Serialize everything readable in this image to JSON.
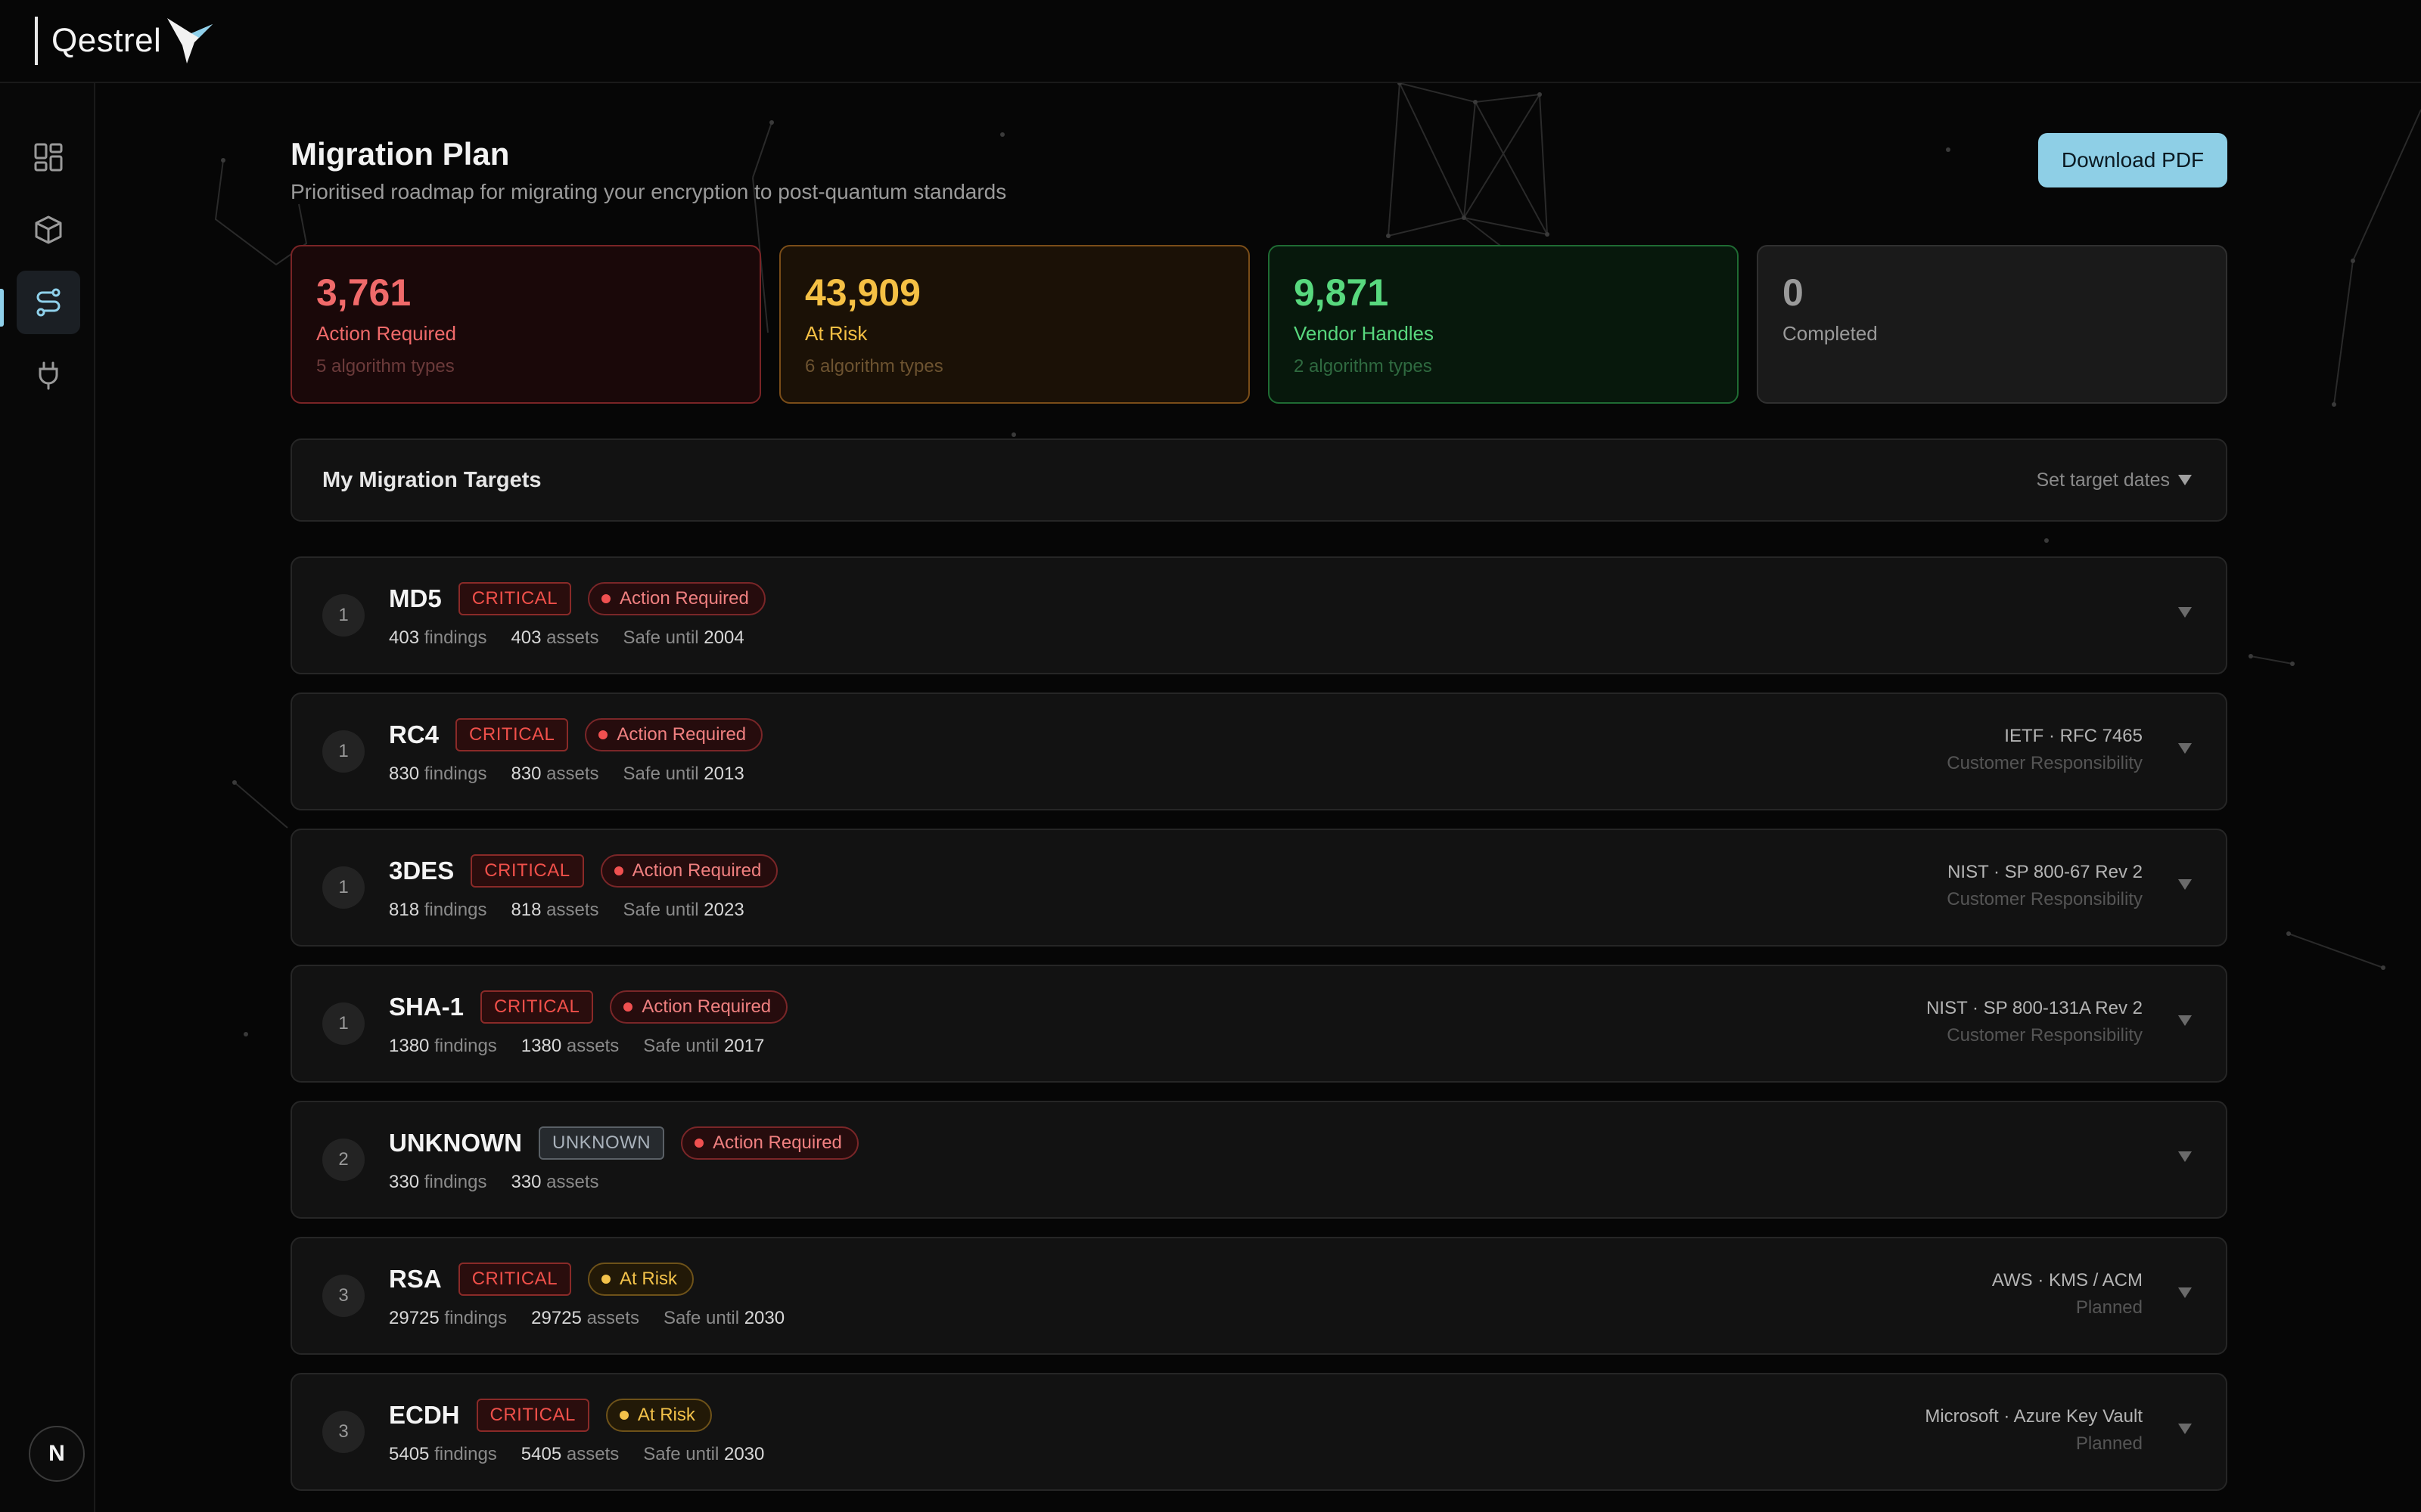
{
  "brand": {
    "name": "Qestrel"
  },
  "sidebar": {
    "items": [
      {
        "name": "dashboard",
        "icon": "dashboard-grid-icon"
      },
      {
        "name": "inventory",
        "icon": "cube-icon"
      },
      {
        "name": "migration",
        "icon": "route-icon",
        "active": true
      },
      {
        "name": "integrations",
        "icon": "plug-icon"
      }
    ],
    "avatar_initial": "N"
  },
  "page": {
    "title": "Migration Plan",
    "subtitle": "Prioritised roadmap for migrating your encryption to post-quantum standards",
    "download_label": "Download PDF"
  },
  "stats": [
    {
      "value": "3,761",
      "label": "Action Required",
      "sub": "5 algorithm types",
      "tone": "red",
      "color": "#f06a6a"
    },
    {
      "value": "43,909",
      "label": "At Risk",
      "sub": "6 algorithm types",
      "tone": "amber",
      "color": "#f5c044"
    },
    {
      "value": "9,871",
      "label": "Vendor Handles",
      "sub": "2 algorithm types",
      "tone": "green",
      "color": "#58d87e"
    },
    {
      "value": "0",
      "label": "Completed",
      "sub": "",
      "tone": "gray",
      "color": "#9a9a9a"
    }
  ],
  "targets": {
    "title": "My Migration Targets",
    "action": "Set target dates"
  },
  "algorithms": [
    {
      "priority": "1",
      "name": "MD5",
      "severity": "CRITICAL",
      "status": "Action Required",
      "findings": "403",
      "assets": "403",
      "safe_until": "2004",
      "ref": "",
      "responsibility": ""
    },
    {
      "priority": "1",
      "name": "RC4",
      "severity": "CRITICAL",
      "status": "Action Required",
      "findings": "830",
      "assets": "830",
      "safe_until": "2013",
      "ref": "IETF · RFC 7465",
      "responsibility": "Customer Responsibility"
    },
    {
      "priority": "1",
      "name": "3DES",
      "severity": "CRITICAL",
      "status": "Action Required",
      "findings": "818",
      "assets": "818",
      "safe_until": "2023",
      "ref": "NIST · SP 800-67 Rev 2",
      "responsibility": "Customer Responsibility"
    },
    {
      "priority": "1",
      "name": "SHA-1",
      "severity": "CRITICAL",
      "status": "Action Required",
      "findings": "1380",
      "assets": "1380",
      "safe_until": "2017",
      "ref": "NIST · SP 800-131A Rev 2",
      "responsibility": "Customer Responsibility"
    },
    {
      "priority": "2",
      "name": "UNKNOWN",
      "severity": "UNKNOWN",
      "status": "Action Required",
      "findings": "330",
      "assets": "330",
      "safe_until": "",
      "ref": "",
      "responsibility": ""
    },
    {
      "priority": "3",
      "name": "RSA",
      "severity": "CRITICAL",
      "status": "At Risk",
      "findings": "29725",
      "assets": "29725",
      "safe_until": "2030",
      "ref": "AWS · KMS / ACM",
      "responsibility": "Planned"
    },
    {
      "priority": "3",
      "name": "ECDH",
      "severity": "CRITICAL",
      "status": "At Risk",
      "findings": "5405",
      "assets": "5405",
      "safe_until": "2030",
      "ref": "Microsoft · Azure Key Vault",
      "responsibility": "Planned"
    }
  ],
  "labels": {
    "findings": "findings",
    "assets": "assets",
    "safe_until": "Safe until"
  }
}
